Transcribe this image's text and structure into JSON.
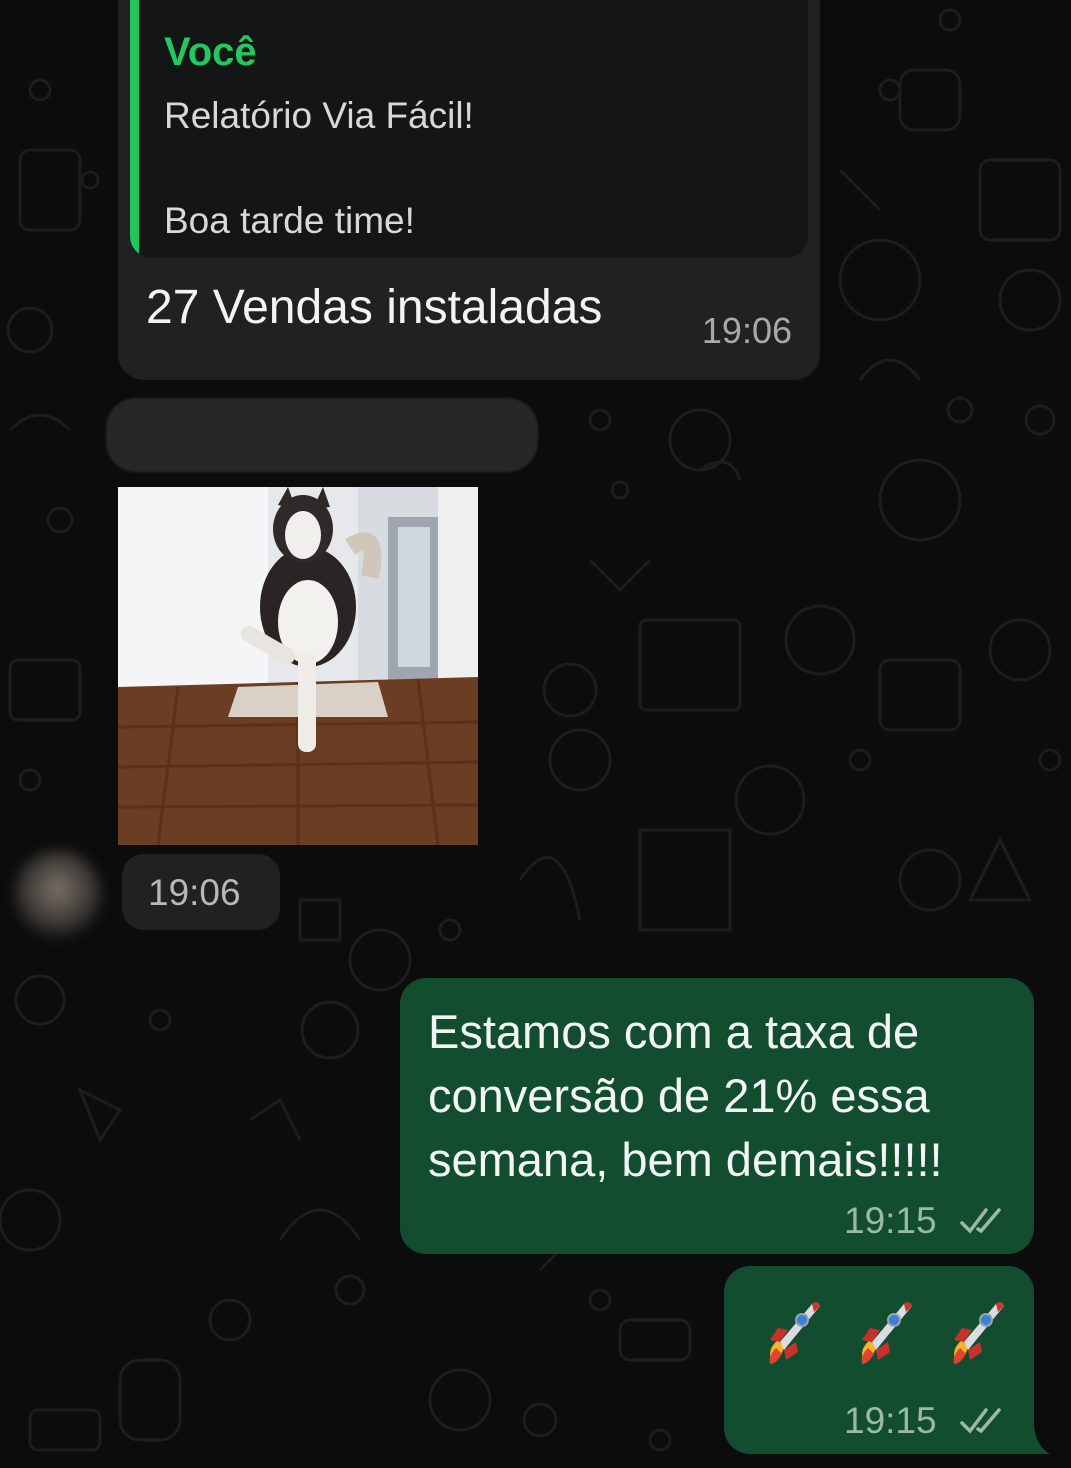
{
  "quoted_message": {
    "author": "Você",
    "line1": "Relatório Via Fácil!",
    "line2": "Boa tarde time!"
  },
  "reply": {
    "text": "27 Vendas instaladas",
    "time": "19:06"
  },
  "gif_message": {
    "time": "19:06",
    "image_description_icon": "dog-gif-image"
  },
  "outgoing_1": {
    "text": "Estamos com a taxa de conversão de 21% essa semana, bem demais!!!!!",
    "time": "19:15",
    "status_icon": "double-check-icon"
  },
  "outgoing_2": {
    "emoji": [
      "rocket-icon",
      "rocket-icon",
      "rocket-icon"
    ],
    "time": "19:15",
    "status_icon": "double-check-icon"
  },
  "colors": {
    "background": "#0b0c0b",
    "incoming_bubble": "#1f2220",
    "outgoing_bubble": "#134d30",
    "quote_accent": "#23c55e"
  }
}
